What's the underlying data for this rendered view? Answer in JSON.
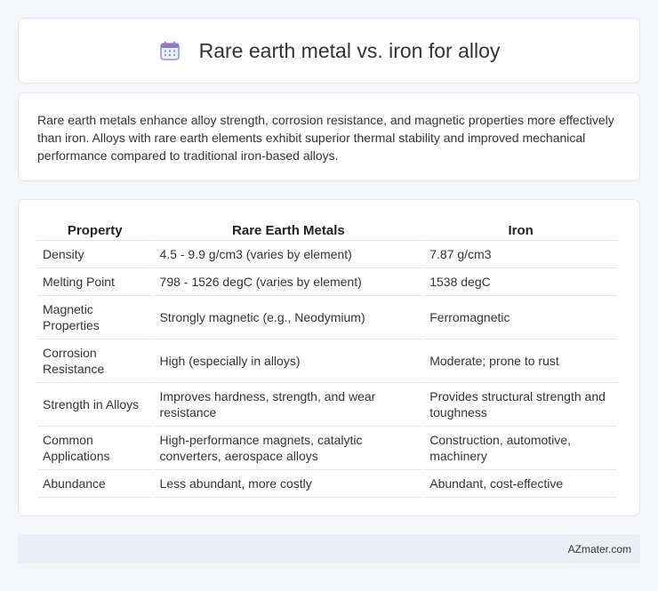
{
  "header": {
    "title": "Rare earth metal vs. iron for alloy",
    "icon": "calendar-icon"
  },
  "intro": {
    "text": "Rare earth metals enhance alloy strength, corrosion resistance, and magnetic properties more effectively than iron. Alloys with rare earth elements exhibit superior thermal stability and improved mechanical performance compared to traditional iron-based alloys."
  },
  "table": {
    "headers": [
      "Property",
      "Rare Earth Metals",
      "Iron"
    ],
    "rows": [
      [
        "Density",
        "4.5 - 9.9 g/cm3 (varies by element)",
        "7.87 g/cm3"
      ],
      [
        "Melting Point",
        "798 - 1526 degC (varies by element)",
        "1538 degC"
      ],
      [
        "Magnetic Properties",
        "Strongly magnetic (e.g., Neodymium)",
        "Ferromagnetic"
      ],
      [
        "Corrosion Resistance",
        "High (especially in alloys)",
        "Moderate; prone to rust"
      ],
      [
        "Strength in Alloys",
        "Improves hardness, strength, and wear resistance",
        "Provides structural strength and toughness"
      ],
      [
        "Common Applications",
        "High-performance magnets, catalytic converters, aerospace alloys",
        "Construction, automotive, machinery"
      ],
      [
        "Abundance",
        "Less abundant, more costly",
        "Abundant, cost-effective"
      ]
    ]
  },
  "footer": {
    "brand": "AZmater.com"
  },
  "colors": {
    "icon_accent": "#7b7fd6",
    "footer_bg": "#e9eef7"
  }
}
